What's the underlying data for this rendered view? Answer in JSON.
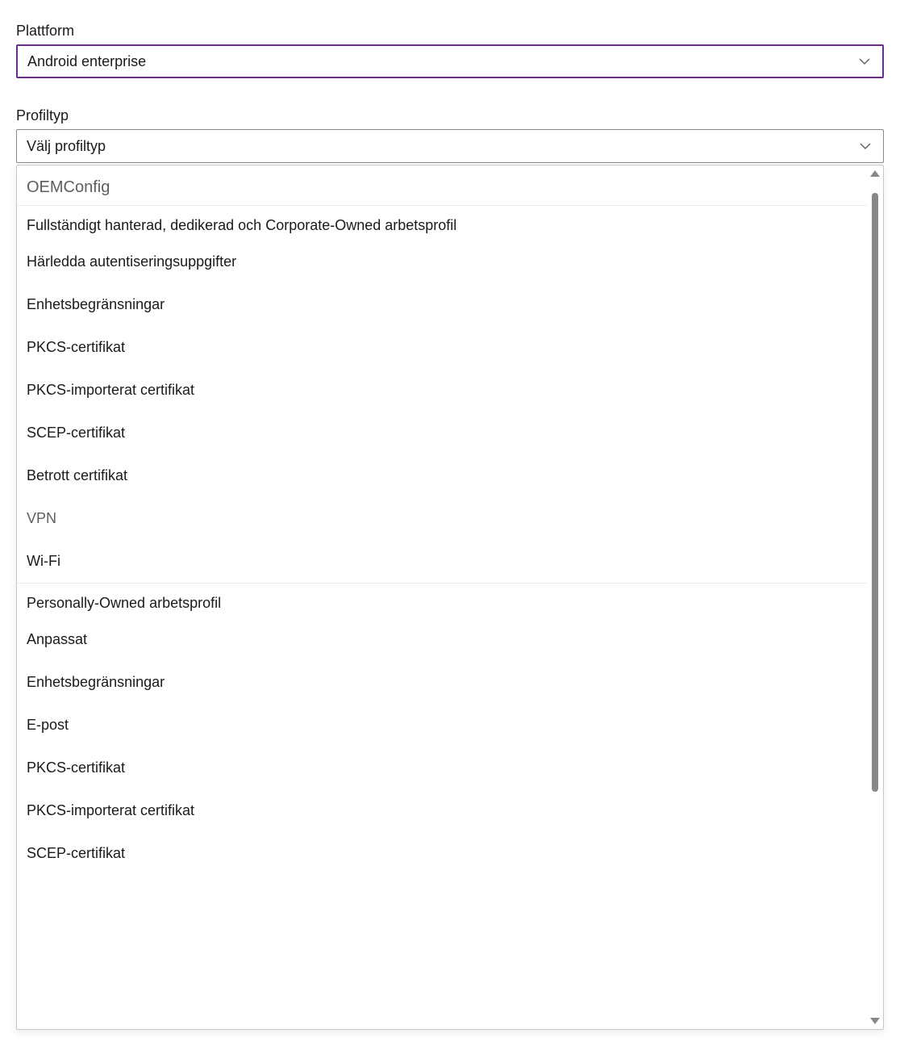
{
  "platform": {
    "label": "Plattform",
    "value": "Android enterprise"
  },
  "profileType": {
    "label": "Profiltyp",
    "placeholder": "Välj profiltyp"
  },
  "dropdown": {
    "topGroup": "OEMConfig",
    "sectionA": {
      "header": "Fullständigt hanterad, dedikerad och Corporate-Owned arbetsprofil",
      "items": [
        "Härledda autentiseringsuppgifter",
        "Enhetsbegränsningar",
        "PKCS-certifikat",
        "PKCS-importerat certifikat",
        "SCEP-certifikat",
        "Betrott certifikat",
        "VPN",
        "Wi-Fi"
      ]
    },
    "sectionB": {
      "header": "Personally-Owned arbetsprofil",
      "items": [
        "Anpassat",
        "Enhetsbegränsningar",
        "E-post",
        "PKCS-certifikat",
        "PKCS-importerat certifikat",
        "SCEP-certifikat"
      ]
    }
  }
}
